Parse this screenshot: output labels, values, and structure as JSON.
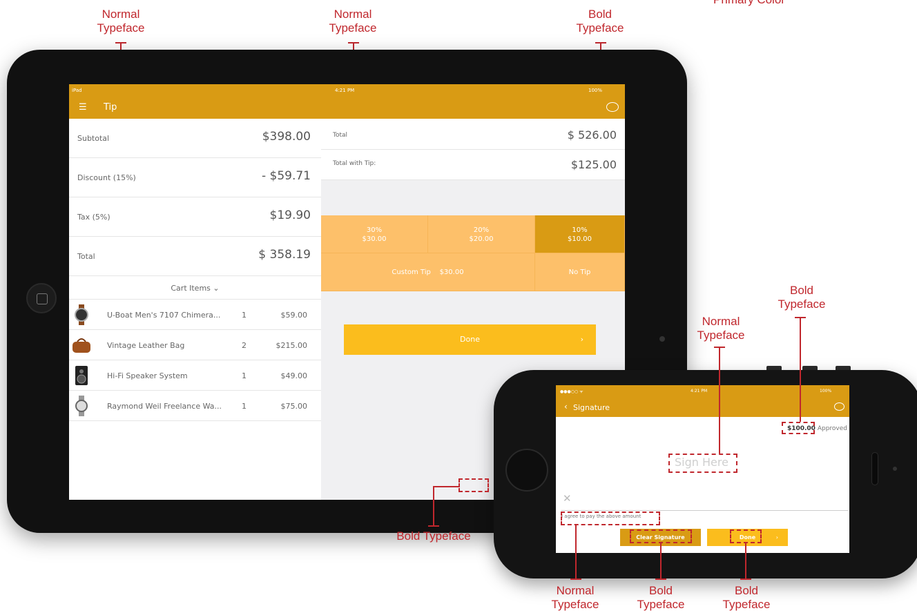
{
  "annotations": {
    "top_left": "Normal Typeface",
    "top_mid": "Normal Typeface",
    "top_right": "Bold Typeface",
    "primary_color": "Primary Color",
    "phone_bold_right": "Bold Typeface",
    "phone_normal": "Normal Typeface",
    "bottom_bold_left": "Bold Typeface",
    "bottom_normal": "Normal Typeface",
    "bottom_bold_mid": "Bold Typeface",
    "bottom_bold_right": "Bold Typeface"
  },
  "colors": {
    "primary": "#d99b14",
    "accent": "#fbbd1d",
    "tip_tile": "#fdc06a",
    "annotation": "#c0272d"
  },
  "ipad": {
    "status": {
      "carrier": "iPad",
      "time": "4:21 PM",
      "battery": "100%"
    },
    "nav": {
      "menu_icon": "hamburger-icon",
      "title": "Tip",
      "chat_icon": "chat-bubble-icon"
    },
    "summary": [
      {
        "label": "Subtotal",
        "value": "$398.00"
      },
      {
        "label": "Discount (15%)",
        "value": "- $59.71"
      },
      {
        "label": "Tax (5%)",
        "value": "$19.90"
      },
      {
        "label": "Total",
        "value": "$ 358.19"
      }
    ],
    "cart_header": "Cart Items",
    "cart": [
      {
        "name": "U-Boat Men's 7107 Chimera...",
        "qty": "1",
        "price": "$59.00",
        "icon": "watch-icon"
      },
      {
        "name": "Vintage Leather Bag",
        "qty": "2",
        "price": "$215.00",
        "icon": "bag-icon"
      },
      {
        "name": "Hi-Fi Speaker System",
        "qty": "1",
        "price": "$49.00",
        "icon": "speaker-icon"
      },
      {
        "name": "Raymond Weil Freelance Wa...",
        "qty": "1",
        "price": "$75.00",
        "icon": "watch-icon"
      }
    ],
    "total": {
      "label": "Total",
      "value": "$ 526.00"
    },
    "total_with_tip": {
      "label": "Total with Tip:",
      "value": "$125.00"
    },
    "tips": [
      {
        "percent": "30%",
        "amount": "$30.00",
        "selected": false
      },
      {
        "percent": "20%",
        "amount": "$20.00",
        "selected": false
      },
      {
        "percent": "10%",
        "amount": "$10.00",
        "selected": true
      }
    ],
    "custom_tip": {
      "label": "Custom Tip",
      "amount": "$30.00"
    },
    "no_tip": "No Tip",
    "done": "Done"
  },
  "iphone": {
    "status": {
      "time": "4:21 PM",
      "battery": "100%"
    },
    "nav": {
      "title": "Signature",
      "chat_icon": "chat-bubble-icon"
    },
    "approved_amount": "$100.00",
    "approved_label": "Approved",
    "sign_placeholder": "Sign Here",
    "agree_text": "I agree to pay the above amount",
    "clear_button": "Clear Signature",
    "done_button": "Done"
  }
}
